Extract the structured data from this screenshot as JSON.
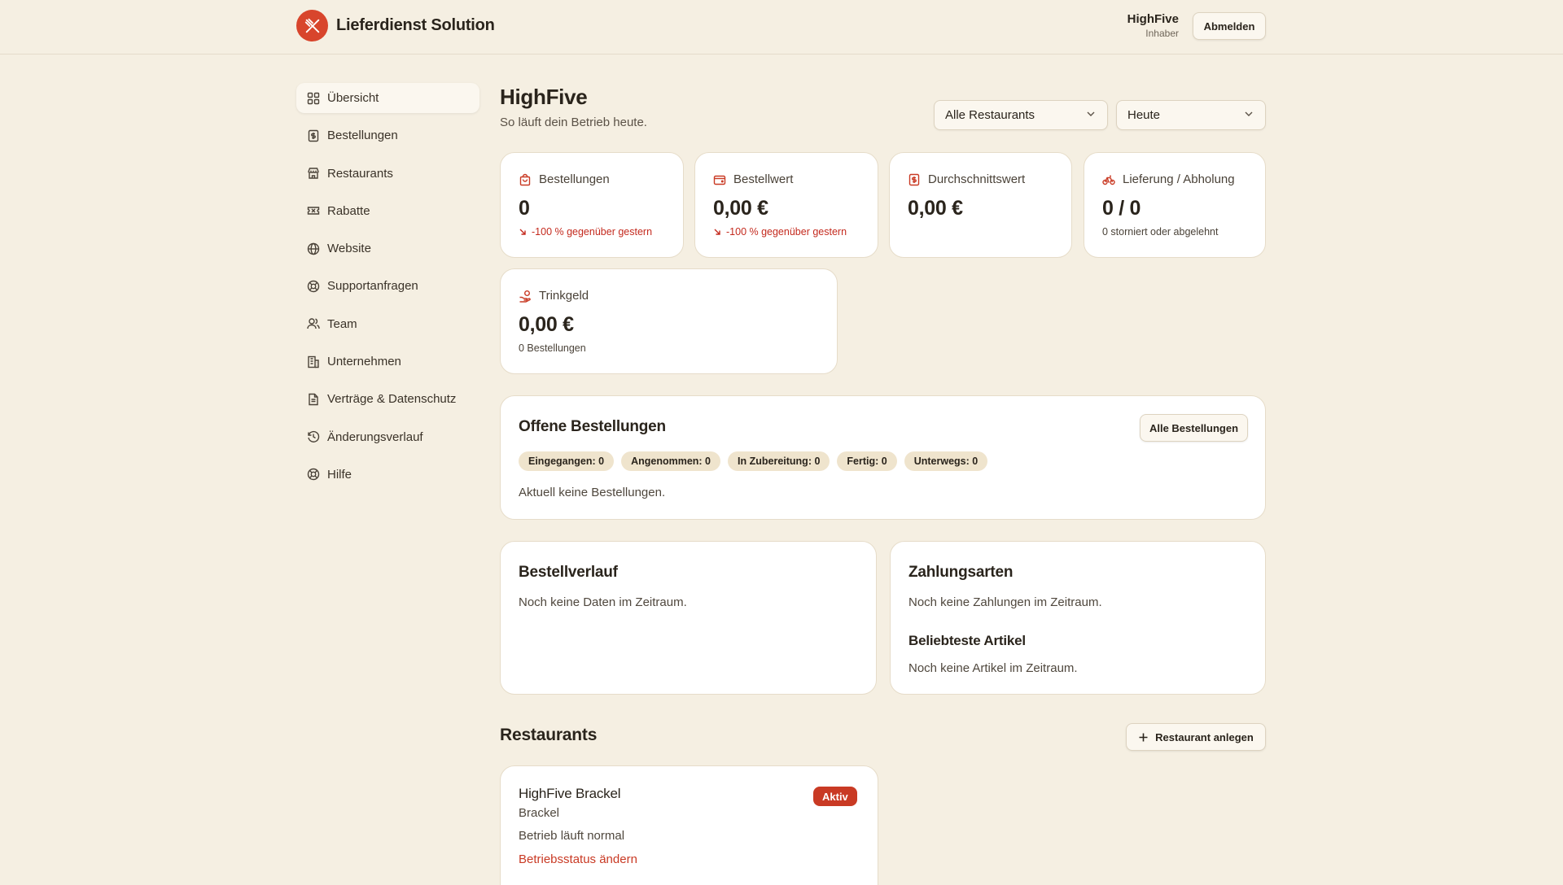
{
  "header": {
    "brand": "Lieferdienst Solution",
    "user_name": "HighFive",
    "user_role": "Inhaber",
    "logout_label": "Abmelden"
  },
  "sidebar": {
    "items": [
      {
        "label": "Übersicht",
        "icon": "dashboard-icon",
        "active": true
      },
      {
        "label": "Bestellungen",
        "icon": "receipt-icon"
      },
      {
        "label": "Restaurants",
        "icon": "store-icon"
      },
      {
        "label": "Rabatte",
        "icon": "ticket-icon"
      },
      {
        "label": "Website",
        "icon": "globe-icon"
      },
      {
        "label": "Supportanfragen",
        "icon": "lifebuoy-icon"
      },
      {
        "label": "Team",
        "icon": "users-icon"
      },
      {
        "label": "Unternehmen",
        "icon": "building-icon"
      },
      {
        "label": "Verträge & Datenschutz",
        "icon": "document-icon"
      },
      {
        "label": "Änderungsverlauf",
        "icon": "history-icon"
      },
      {
        "label": "Hilfe",
        "icon": "help-icon"
      }
    ]
  },
  "main": {
    "title": "HighFive",
    "subtitle": "So läuft dein Betrieb heute.",
    "filter_restaurant": "Alle Restaurants",
    "filter_period": "Heute"
  },
  "stats": {
    "orders": {
      "label": "Bestellungen",
      "value": "0",
      "note": "-100 % gegenüber gestern"
    },
    "order_value": {
      "label": "Bestellwert",
      "value": "0,00 €",
      "note": "-100 % gegenüber gestern"
    },
    "average": {
      "label": "Durchschnittswert",
      "value": "0,00 €"
    },
    "delivery": {
      "label": "Lieferung / Abholung",
      "value": "0 / 0",
      "note": "0 storniert oder abgelehnt"
    },
    "tip": {
      "label": "Trinkgeld",
      "value": "0,00 €",
      "note": "0 Bestellungen"
    }
  },
  "open_orders": {
    "title": "Offene Bestellungen",
    "button": "Alle Bestellungen",
    "chips": [
      "Eingegangen: 0",
      "Angenommen: 0",
      "In Zubereitung: 0",
      "Fertig: 0",
      "Unterwegs: 0"
    ],
    "empty": "Aktuell keine Bestellungen."
  },
  "history": {
    "title": "Bestellverlauf",
    "empty": "Noch keine Daten im Zeitraum."
  },
  "payments": {
    "title": "Zahlungsarten",
    "empty": "Noch keine Zahlungen im Zeitraum.",
    "popular_title": "Beliebteste Artikel",
    "popular_empty": "Noch keine Artikel im Zeitraum."
  },
  "restaurants": {
    "title": "Restaurants",
    "add_button": "Restaurant anlegen",
    "items": [
      {
        "name": "HighFive Brackel",
        "city": "Brackel",
        "status": "Aktiv",
        "state": "Betrieb läuft normal",
        "action": "Betriebsstatus ändern"
      }
    ]
  },
  "colors": {
    "accent": "#c93a24",
    "background": "#f5efe2",
    "card": "#ffffff"
  }
}
